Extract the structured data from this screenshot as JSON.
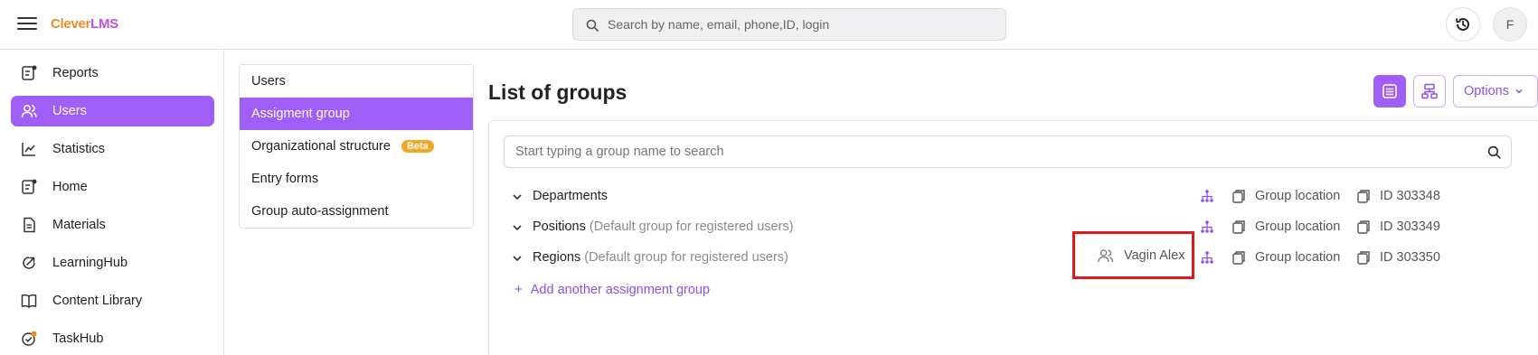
{
  "header": {
    "logo_part1": "Clever",
    "logo_part2": "LMS",
    "search_placeholder": "Search by name, email, phone,ID, login",
    "avatar_initial": "F"
  },
  "sidebar": {
    "items": [
      {
        "label": "Reports",
        "icon": "reports-icon"
      },
      {
        "label": "Users",
        "icon": "users-icon",
        "active": true
      },
      {
        "label": "Statistics",
        "icon": "statistics-icon"
      },
      {
        "label": "Home",
        "icon": "home-icon"
      },
      {
        "label": "Materials",
        "icon": "materials-icon"
      },
      {
        "label": "LearningHub",
        "icon": "learninghub-icon"
      },
      {
        "label": "Content Library",
        "icon": "book-icon"
      },
      {
        "label": "TaskHub",
        "icon": "taskhub-icon"
      }
    ]
  },
  "submenu": {
    "items": [
      {
        "label": "Users"
      },
      {
        "label": "Assigment group",
        "active": true
      },
      {
        "label": "Organizational structure",
        "badge": "Beta"
      },
      {
        "label": "Entry forms"
      },
      {
        "label": "Group auto-assignment"
      }
    ]
  },
  "main": {
    "title": "List of groups",
    "options_label": "Options",
    "group_search_placeholder": "Start typing a group name to search",
    "groups": [
      {
        "name": "Departments",
        "note": "",
        "location": "Group location",
        "id_label": "ID 303348"
      },
      {
        "name": "Positions",
        "note": "(Default group for registered users)",
        "location": "Group location",
        "id_label": "ID 303349"
      },
      {
        "name": "Regions",
        "note": "(Default group for registered users)",
        "location": "Group location",
        "id_label": "ID 303350",
        "owner": "Vagin Alex"
      }
    ],
    "add_group_label": "Add another assignment group"
  },
  "colors": {
    "accent": "#9f5ef5",
    "beta_badge": "#f5a623",
    "highlight_box": "#e01a1a"
  }
}
